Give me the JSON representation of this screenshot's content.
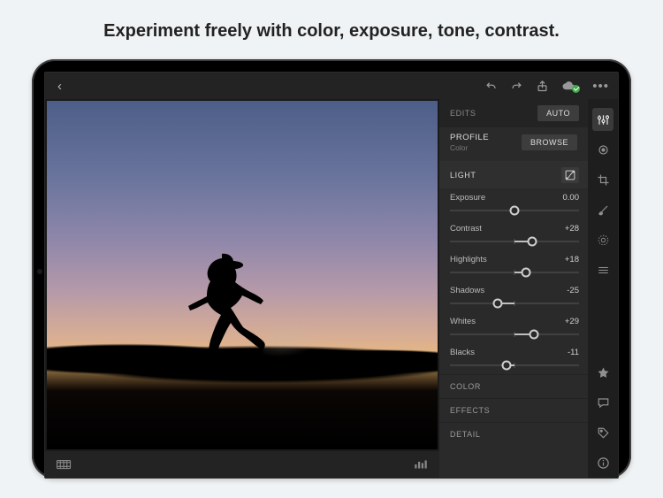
{
  "headline": "Experiment freely with color, exposure, tone, contrast.",
  "topbar": {
    "back": "‹"
  },
  "panel": {
    "edits_label": "EDITS",
    "auto_label": "AUTO",
    "profile": {
      "label": "PROFILE",
      "value": "Color",
      "browse": "BROWSE"
    },
    "light_label": "LIGHT",
    "sliders": [
      {
        "name": "Exposure",
        "value": "0.00",
        "pos": 50,
        "fillFrom": 50,
        "fillTo": 50
      },
      {
        "name": "Contrast",
        "value": "+28",
        "pos": 64,
        "fillFrom": 50,
        "fillTo": 64
      },
      {
        "name": "Highlights",
        "value": "+18",
        "pos": 59,
        "fillFrom": 50,
        "fillTo": 59
      },
      {
        "name": "Shadows",
        "value": "-25",
        "pos": 37,
        "fillFrom": 37,
        "fillTo": 50
      },
      {
        "name": "Whites",
        "value": "+29",
        "pos": 65,
        "fillFrom": 50,
        "fillTo": 65
      },
      {
        "name": "Blacks",
        "value": "-11",
        "pos": 44,
        "fillFrom": 44,
        "fillTo": 50
      }
    ],
    "collapsed": [
      "COLOR",
      "EFFECTS",
      "DETAIL"
    ]
  }
}
